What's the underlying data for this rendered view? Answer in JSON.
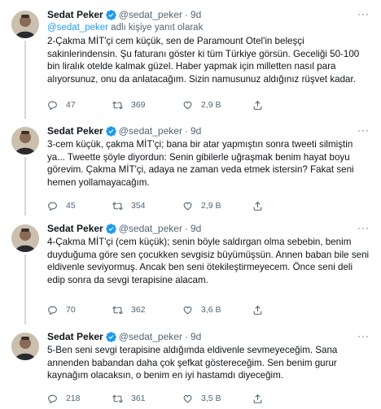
{
  "colors": {
    "link": "#1d9bf0",
    "muted": "#536471",
    "verified": "#1d9bf0",
    "thread_line": "#cfd9de"
  },
  "icons": [
    "avatar-photo",
    "verified-badge-icon",
    "more-icon",
    "reply-icon",
    "retweet-icon",
    "like-icon",
    "share-icon"
  ],
  "tweets": [
    {
      "name": "Sedat Peker",
      "handle": "@sedat_peker",
      "dot": "·",
      "time": "9d",
      "reply_to_mention": "@sedat_peker",
      "reply_to_suffix": " adlı kişiye yanıt olarak",
      "text": "2-Çakma MİT'çi cem küçük, sen de Paramount Otel'in beleşçi\nsakinlerindensin.  Şu faturanı göster ki tüm Türkiye görsün. Geceliği 50-100\nbin liralık otelde kalmak güzel. Haber yapmak için milletten nasıl para\nalıyorsunuz, onu da anlatacağım. Sizin namusunuz aldığınız rüşvet kadar.",
      "replies": "47",
      "retweets": "369",
      "likes": "2,9 B"
    },
    {
      "name": "Sedat Peker",
      "handle": "@sedat_peker",
      "dot": "·",
      "time": "9d",
      "text": "3-cem küçük, çakma MİT'çi; bana bir atar yapmıştın sonra tweeti silmiştin\nya... Tweette şöyle diyordun: Senin gibilerle uğraşmak benim hayat boyu\ngörevim. Çakma MİT'çi, adaya ne zaman veda etmek istersin? Fakat seni\nhemen yollamayacağım.",
      "replies": "45",
      "retweets": "354",
      "likes": "2,9 B"
    },
    {
      "name": "Sedat Peker",
      "handle": "@sedat_peker",
      "dot": "·",
      "time": "9d",
      "text": "4-Çakma MİT'çi (cem küçük); senin böyle saldırgan olma sebebin, benim\nduyduğuma göre sen çocukken sevgisiz büyümüşsün. Annen baban bile seni\neldivenle seviyormuş. Ancak ben seni ötekileştirmeyecem. Önce seni deli\nedip sonra da sevgi terapisine alacam.",
      "replies": "70",
      "retweets": "362",
      "likes": "3,6 B"
    },
    {
      "name": "Sedat Peker",
      "handle": "@sedat_peker",
      "dot": "·",
      "time": "9d",
      "text": "5-Ben seni sevgi terapisine aldığımda eldivenle sevmeyeceğim. Sana\nannenden babandan daha çok şefkat göstereceğim. Sen benim gurur\nkaynağım olacaksın, o benim en iyi hastamdı diyeceğim.",
      "replies": "218",
      "retweets": "361",
      "likes": "3,5 B"
    }
  ]
}
